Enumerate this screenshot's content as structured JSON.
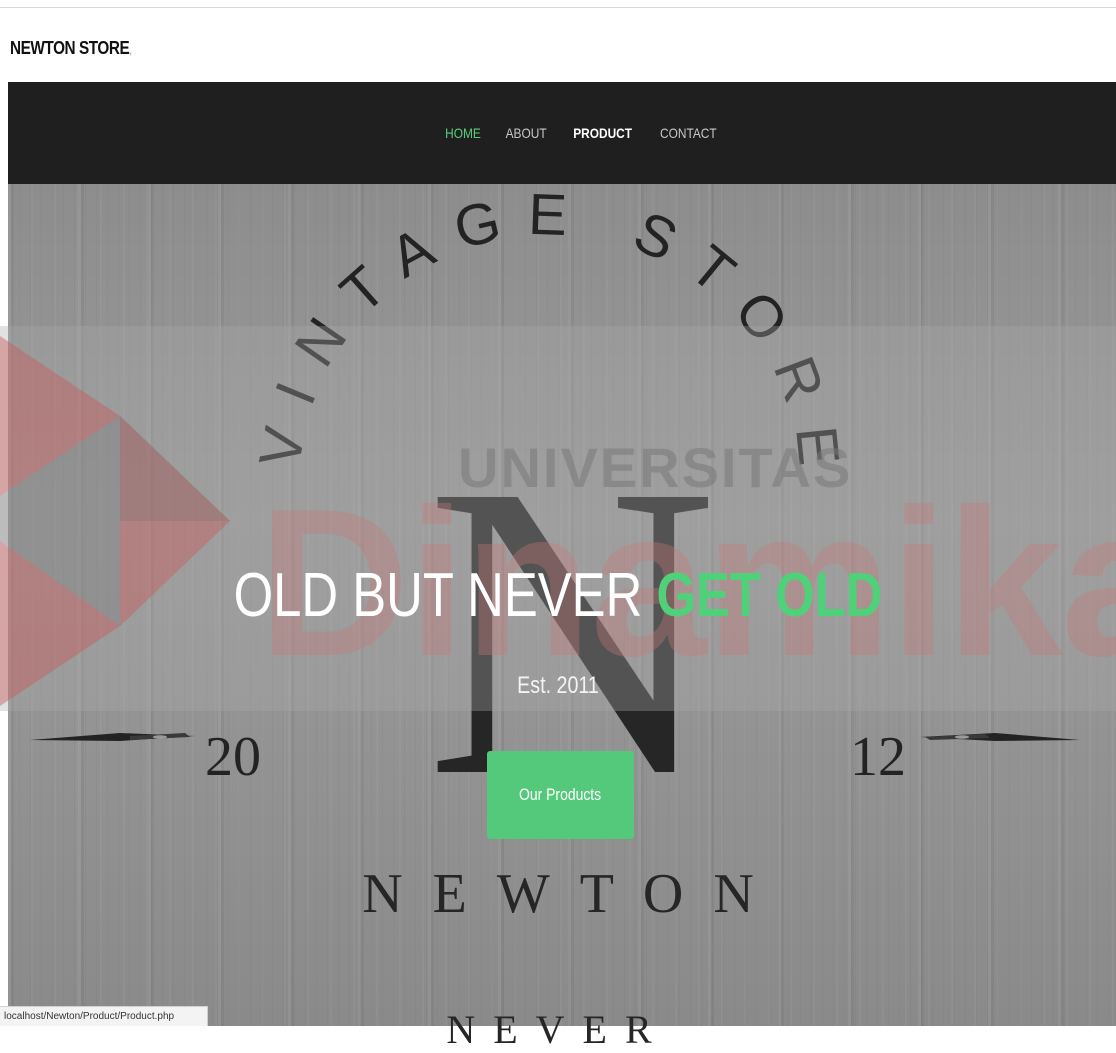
{
  "page": {
    "title": "NEWTON STORE",
    "title_suffix": ","
  },
  "nav": {
    "items": [
      {
        "label": "HOME"
      },
      {
        "label": "ABOUT"
      },
      {
        "label": "PRODUCT"
      },
      {
        "label": "CONTACT"
      }
    ],
    "active_color": "#5bd07a"
  },
  "hero": {
    "arc_text": "VINTAGE STORE",
    "year_left": "20",
    "year_right": "12",
    "monogram": "N",
    "tagline_plain": "OLD BUT NEVER ",
    "tagline_accent": "GET OLD",
    "established": "Est. 2011",
    "cta_label": "Our Products",
    "brand_word": "NEWTON",
    "bottom_word": "NEVER",
    "accent_color": "#4fd17a",
    "button_color": "#55c97b"
  },
  "watermark": {
    "top_text": "UNIVERSITAS",
    "big_text": "Dinamika"
  },
  "status_bar": {
    "url": "localhost/Newton/Product/Product.php"
  }
}
